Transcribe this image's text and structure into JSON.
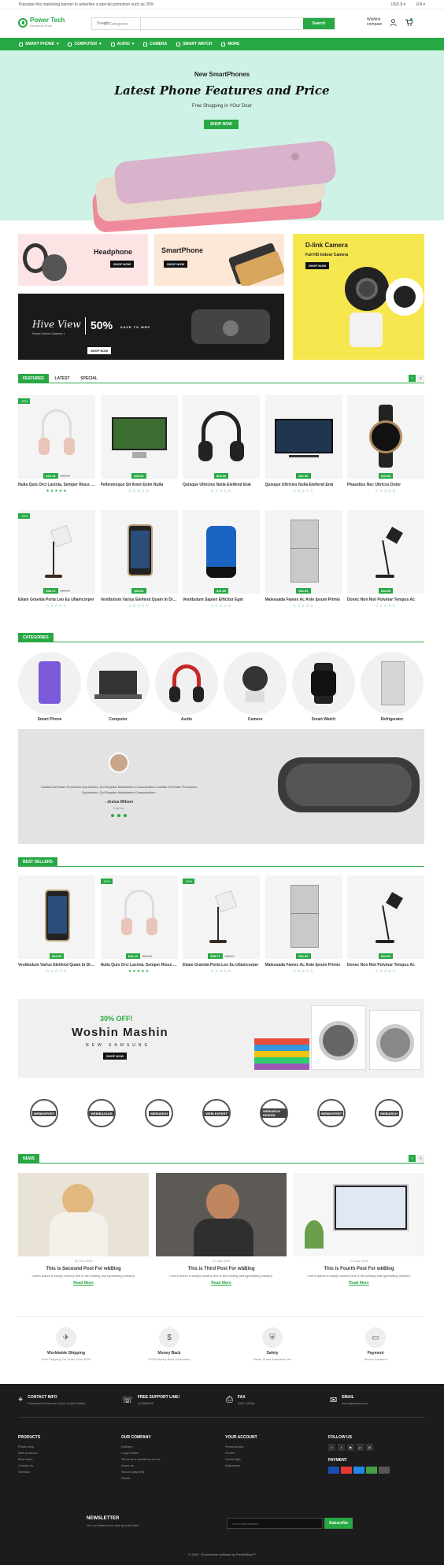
{
  "topbar": {
    "message": "Populate this marketing banner to advertise a special promotion such as 20%",
    "currency": "USD $",
    "language": "EN"
  },
  "logo": {
    "name": "Power Tech",
    "tagline": "Electronic Shop"
  },
  "search": {
    "category": "All Categories",
    "placeholder": "Search",
    "button": "Search"
  },
  "header": {
    "wishlist": "Wishlist",
    "compare": "compare"
  },
  "nav": [
    "SMART PHONE",
    "COMPUTER",
    "AUDIO",
    "CAMERA",
    "SMART WATCH",
    "MORE"
  ],
  "hero": {
    "subtitle": "New SmartPhones",
    "title": "Latest Phone Features and Price",
    "text": "Free Shopping in YOur Door",
    "button": "SHOP NOW"
  },
  "banners": {
    "headphone": "Headphone",
    "smartphone": "SmartPhone",
    "shop_now": "SHOP NOW",
    "dlink": "D-link Camera",
    "dlink_sub": "Full HD Indoor Camera",
    "hive": "Hive View",
    "hive_sub": "Smart Drone Camera 1",
    "pct": "50%",
    "save": "SAVE TO MRP"
  },
  "featured": {
    "tabs": [
      "FEATURED",
      "LATEST",
      "SPECIAL"
    ],
    "products": [
      {
        "name": "Nulla Quis Orci Lacinia, Semper Risus Eget",
        "price": "$19.13",
        "old": "$20.00",
        "sale": "-20%",
        "stars": "★★★★★",
        "kind": "headphone-white"
      },
      {
        "name": "Pellentesque Sit Amet Enim Nulla",
        "price": "$25.00",
        "old": "",
        "sale": "",
        "stars": "☆☆☆☆☆",
        "kind": "monitor"
      },
      {
        "name": "Quisque Ultricies Nulla Eleifend Erat",
        "price": "$25.00",
        "old": "",
        "sale": "",
        "stars": "☆☆☆☆☆",
        "kind": "headphone-black"
      },
      {
        "name": "Quisque Ultricies Nulla Eleifend Erat",
        "price": "$11.90",
        "old": "",
        "sale": "",
        "stars": "☆☆☆☆☆",
        "kind": "tv"
      },
      {
        "name": "Phasellus Nec Ultrices Dolor",
        "price": "$18.90",
        "old": "",
        "sale": "",
        "stars": "☆☆☆☆☆",
        "kind": "watch"
      },
      {
        "name": "Etiam Gravida Porta Leo Eu Ullamcorper",
        "price": "$38.72",
        "old": "$38.90",
        "sale": "-20%",
        "stars": "☆☆☆☆☆",
        "kind": "lamp"
      },
      {
        "name": "Vestibulum Varius Eleifend Quam In Dignissim",
        "price": "$29.00",
        "old": "",
        "sale": "",
        "stars": "☆☆☆☆☆",
        "kind": "phone"
      },
      {
        "name": "Vestibulum Sapien Efficitur Eget",
        "price": "$11.90",
        "old": "",
        "sale": "",
        "stars": "☆☆☆☆☆",
        "kind": "speaker"
      },
      {
        "name": "Malesuada Fames Ac Ante Ipsum Primis",
        "price": "$11.90",
        "old": "",
        "sale": "",
        "stars": "☆☆☆☆☆",
        "kind": "fridge"
      },
      {
        "name": "Donec Non Nisl Pulvinar Tempus Ac",
        "price": "$18.90",
        "old": "",
        "sale": "",
        "stars": "☆☆☆☆☆",
        "kind": "lamp2"
      }
    ]
  },
  "categories": {
    "title": "CATEGORIES",
    "items": [
      "Smart Phone",
      "Computer",
      "Audio",
      "Camera",
      "Smart Watch",
      "Refrigerator"
    ]
  },
  "testimonial": {
    "text": "Claritas Est Etiam Processus Dynamicus, Qui Sequitur Mutationem Consuetudium Claritas Est Etiam Processus Dynamicus, Qui Sequitur Mutationem Consuetudium",
    "author": "- Jesica Wilson",
    "role": "Fashion"
  },
  "bestsellers": {
    "title": "BEST SELLERS",
    "products": [
      {
        "name": "Vestibulum Varius Eleifend Quam In Dignissim",
        "price": "$29.00",
        "old": "",
        "sale": "",
        "stars": "☆☆☆☆☆",
        "kind": "phone"
      },
      {
        "name": "Nulla Quis Orci Lacinia, Semper Risus Eget",
        "price": "$19.13",
        "old": "$20.00",
        "sale": "-20%",
        "stars": "★★★★★",
        "kind": "headphone-white"
      },
      {
        "name": "Etiam Gravida Porta Leo Eu Ullamcorper",
        "price": "$38.72",
        "old": "$38.90",
        "sale": "-20%",
        "stars": "☆☆☆☆☆",
        "kind": "lamp"
      },
      {
        "name": "Malesuada Fames Ac Ante Ipsum Primis",
        "price": "$11.90",
        "old": "",
        "sale": "",
        "stars": "☆☆☆☆☆",
        "kind": "fridge"
      },
      {
        "name": "Donec Non Nisl Pulvinar Tempus Ac",
        "price": "$18.90",
        "old": "",
        "sale": "",
        "stars": "☆☆☆☆☆",
        "kind": "lamp2"
      }
    ]
  },
  "washer": {
    "off": "30% OFF!",
    "title": "Woshin Mashin",
    "brand": "NEW SAMSUNG",
    "button": "SHOP NOW"
  },
  "brands": [
    "WEBIEXPERT",
    "WEBIBAZAAR",
    "WEBIARCH",
    "WEBI EXPERT",
    "WEBIARCH DESIGN",
    "WEBIEXPERT",
    "WEBIARCH"
  ],
  "news": {
    "title": "NEWS",
    "posts": [
      {
        "date": "21 July 2019",
        "title": "This is Secound Post For wbBlog",
        "desc": "Lorem Ipsum is simply dummy text of the printing and typesetting industry.",
        "more": "Read More"
      },
      {
        "date": "21 July 2019",
        "title": "This is Third Post For wbBlog",
        "desc": "Lorem Ipsum is simply dummy text of the printing and typesetting industry.",
        "more": "Read More"
      },
      {
        "date": "21 July 2019",
        "title": "This is Fourth Post For wbBlog",
        "desc": "Lorem Ipsum is simply dummy text of the printing and typesetting industry.",
        "more": "Read More"
      }
    ]
  },
  "services": [
    {
      "t": "Worldwide Shipping",
      "s": "Free Shipping On Order Over $100"
    },
    {
      "t": "Money Back",
      "s": "100% Money Back Guarantee"
    },
    {
      "t": "Safety",
      "s": "Never Share Individual Info"
    },
    {
      "t": "Payment",
      "s": "Secure Payment"
    }
  ],
  "footer": {
    "contact": [
      {
        "t": "CONTACT INFO",
        "s": "Powertech Electronic Store United States"
      },
      {
        "t": "FREE SUPPORT LINE!",
        "s": "123456789"
      },
      {
        "t": "FAX",
        "s": "0261-12546"
      },
      {
        "t": "EMAIL",
        "s": "demo@demo.com"
      }
    ],
    "products": {
      "title": "PRODUCTS",
      "links": [
        "Prices drop",
        "New products",
        "Best sales",
        "Contact us",
        "Sitemap"
      ]
    },
    "company": {
      "title": "OUR COMPANY",
      "links": [
        "Delivery",
        "Legal Notice",
        "Terms and conditions of use",
        "About us",
        "Secure payment",
        "Stores"
      ]
    },
    "account": {
      "title": "YOUR ACCOUNT",
      "links": [
        "Personal info",
        "Orders",
        "Credit slips",
        "Addresses"
      ]
    },
    "follow": "FOLLOW US",
    "payment": "PAYMENT",
    "newsletter": {
      "title": "NEWSLETTER",
      "sub": "Get our latest news and special sales",
      "placeholder": "Your email address",
      "button": "Subscribe"
    },
    "copyright": "© 2019 - Ecommerce software by PrestaShop™"
  }
}
